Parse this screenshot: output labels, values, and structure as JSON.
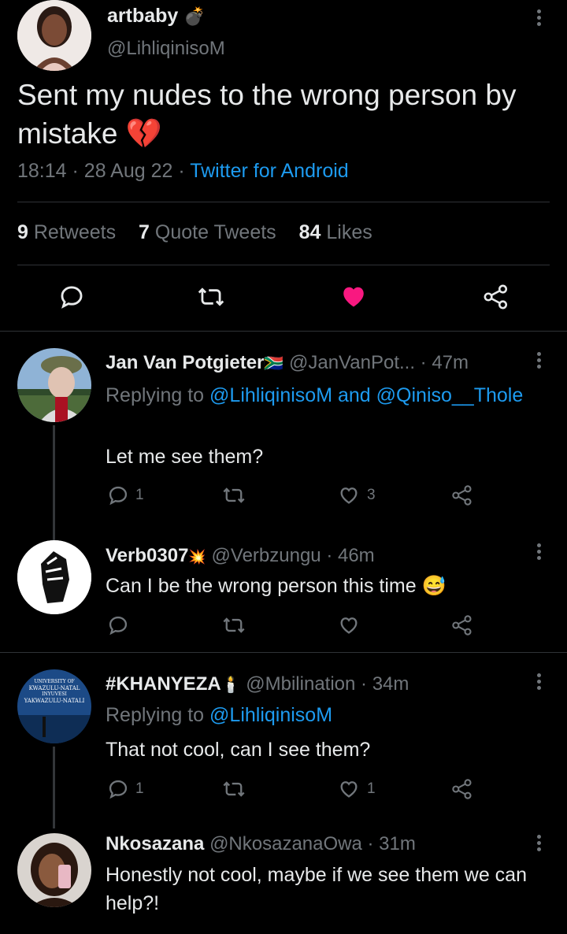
{
  "main_tweet": {
    "display_name": "artbaby",
    "name_emoji": "💣",
    "handle": "@LihliqinisoM",
    "text": "Sent my nudes to the wrong person by mistake",
    "text_emoji": "💔",
    "time": "18:14",
    "date": "28 Aug 22",
    "source": "Twitter for Android",
    "separator": "·",
    "stats": {
      "retweets_count": "9",
      "retweets_label": "Retweets",
      "quotes_count": "7",
      "quotes_label": "Quote Tweets",
      "likes_count": "84",
      "likes_label": "Likes"
    }
  },
  "replies": [
    {
      "name": "Jan Van Potgieter",
      "badge": "🇿🇦",
      "handle": "@JanVanPot...",
      "time": "· 47m",
      "replying_prefix": "Replying to",
      "replying_to_1": "@LihliqinisoM",
      "replying_and": "and",
      "replying_to_2": "@Qiniso__Thole",
      "text": "Let me see them?",
      "reply_count": "1",
      "retweet_count": "",
      "like_count": "3"
    },
    {
      "name": "Verb0307",
      "badge": "💥",
      "handle": "@Verbzungu",
      "time": "· 46m",
      "text": "Can I be the wrong person this time",
      "text_emoji": "😅",
      "reply_count": "",
      "retweet_count": "",
      "like_count": ""
    },
    {
      "name": "#KHANYEZA",
      "badge": "🕯️",
      "handle": "@Mbilination",
      "time": "· 34m",
      "replying_prefix": "Replying to",
      "replying_to_1": "@LihliqinisoM",
      "text": "That not cool, can I see them?",
      "avatar_text_1": "UNIVERSITY OF",
      "avatar_text_2": "KWAZULU-NATAL",
      "avatar_text_3": "INYUVESI",
      "avatar_text_4": "YAKWAZULU-NATALI",
      "reply_count": "1",
      "retweet_count": "",
      "like_count": "1"
    },
    {
      "name": "Nkosazana",
      "handle": "@NkosazanaOwa",
      "time": "· 31m",
      "text": "Honestly not cool, maybe if we see them we can help?!"
    }
  ],
  "colors": {
    "background": "#000000",
    "text": "#e7e9ea",
    "secondary": "#71767b",
    "link": "#1d9bf0",
    "like": "#f91880",
    "divider": "#2f3336"
  }
}
